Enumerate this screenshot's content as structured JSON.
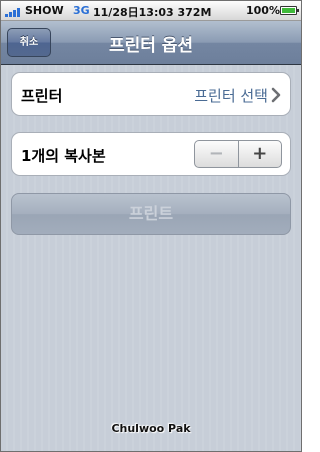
{
  "status_bar": {
    "carrier": "SHOW",
    "network": "3G",
    "clock": "11/28日13:03 372M",
    "battery_pct": "100%"
  },
  "nav": {
    "cancel_label": "취소",
    "title": "프린터 옵션"
  },
  "printer_row": {
    "label": "프린터",
    "value": "프린터 선택"
  },
  "copies_row": {
    "label": "1개의 복사본",
    "minus": "−",
    "plus": "+"
  },
  "print_button": {
    "label": "프린트"
  },
  "watermark": "Chulwoo Pak",
  "colors": {
    "accent": "#4a6b94",
    "nav_bar": "#7486a2",
    "battery": "#3fb93a",
    "network": "#2a6fd6"
  }
}
